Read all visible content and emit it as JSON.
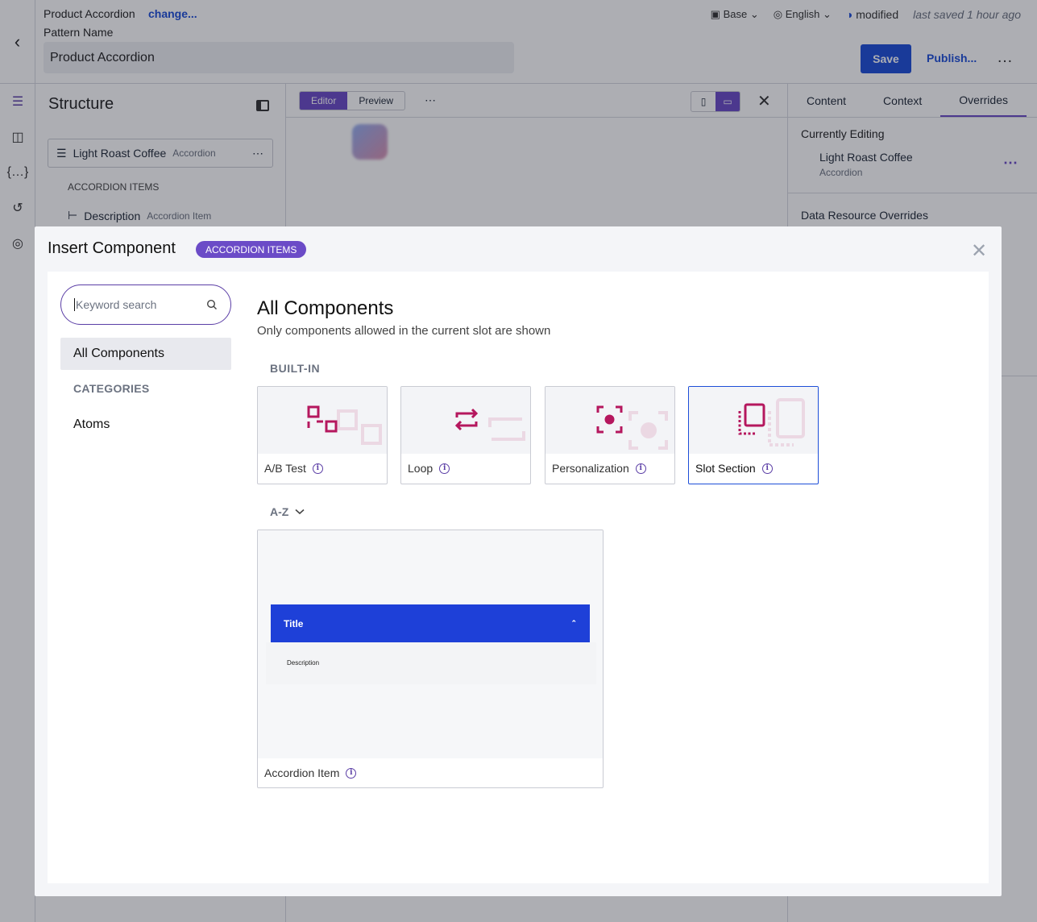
{
  "header": {
    "pattern_title": "Product Accordion",
    "change_link": "change...",
    "pattern_name_label": "Pattern Name",
    "pattern_name_value": "Product Accordion",
    "base_label": "Base",
    "language": "English",
    "status": "modified",
    "last_saved": "last saved 1 hour ago",
    "save_label": "Save",
    "publish_label": "Publish..."
  },
  "structure": {
    "title": "Structure",
    "root_name": "Light Roast Coffee",
    "root_type": "Accordion",
    "section_label": "ACCORDION ITEMS",
    "child_name": "Description",
    "child_type": "Accordion Item"
  },
  "canvas": {
    "editor_tab": "Editor",
    "preview_tab": "Preview"
  },
  "props": {
    "tabs": [
      "Content",
      "Context",
      "Overrides"
    ],
    "currently_editing_label": "Currently Editing",
    "current_name": "Light Roast Coffee",
    "current_type": "Accordion",
    "data_resource_overrides": "Data Resource Overrides"
  },
  "modal": {
    "title": "Insert Component",
    "badge": "ACCORDION ITEMS",
    "search_placeholder": "Keyword search",
    "nav_all": "All Components",
    "nav_categories": "CATEGORIES",
    "nav_atoms": "Atoms",
    "main_title": "All Components",
    "main_subtitle": "Only components allowed in the current slot are shown",
    "builtin_label": "BUILT-IN",
    "builtin": [
      {
        "label": "A/B Test",
        "icon": "ab-test-icon"
      },
      {
        "label": "Loop",
        "icon": "loop-icon"
      },
      {
        "label": "Personalization",
        "icon": "personalization-icon"
      },
      {
        "label": "Slot Section",
        "icon": "slot-section-icon",
        "selected": true
      }
    ],
    "az_label": "A-Z",
    "az_card": {
      "label": "Accordion Item",
      "preview_title": "Title",
      "preview_description": "Description"
    }
  },
  "colors": {
    "accent": "#6b4bc7",
    "primary": "#1d4ed8",
    "icon_magenta": "#b5175e"
  }
}
